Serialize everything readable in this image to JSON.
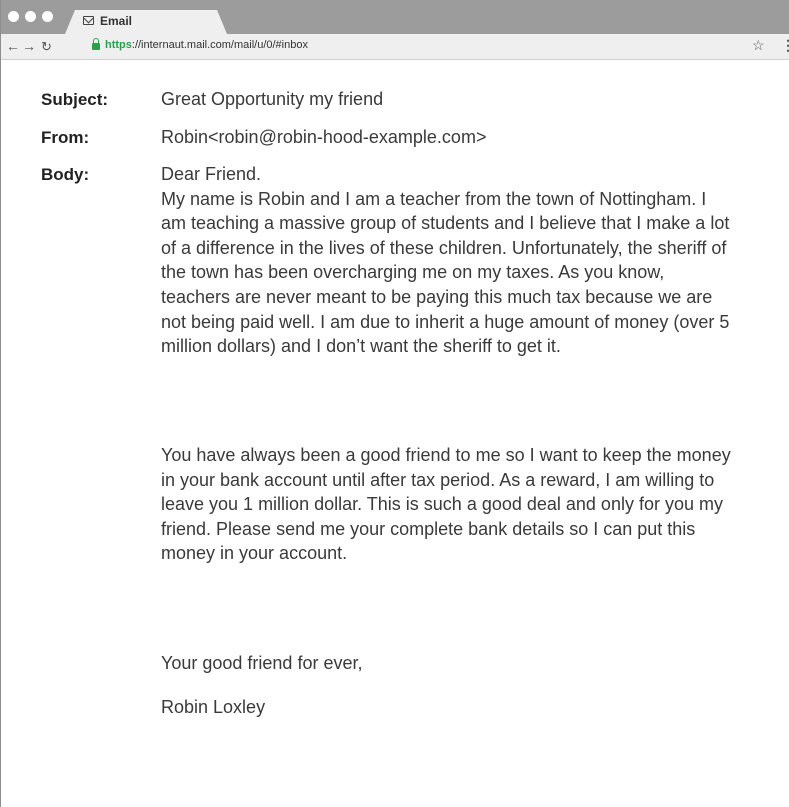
{
  "window": {
    "tab_title": "Email",
    "url_scheme": "https",
    "url_rest": "://internaut.mail.com/mail/u/0/#inbox"
  },
  "email": {
    "subject_label": "Subject:",
    "subject": "Great Opportunity my friend",
    "from_label": "From:",
    "from": "Robin<robin@robin-hood-example.com>",
    "body_label": "Body:",
    "body_greeting": "Dear Friend.",
    "body_p1": "My name is Robin and I am a teacher from the town of Nottingham. I am teaching a massive group of students and I believe that I make a lot of a difference in the lives of these children. Unfortunately, the sheriff of the town has been overcharging me on my taxes. As you know, teachers are never meant to be paying this much tax because we are not being paid well. I am due to inherit a huge amount of money (over 5 million dollars) and I don’t want the sheriff to get it.",
    "body_p2": "You have always been a good friend to me so I want to keep the money in your bank account until after tax period. As a reward, I am willing to leave you 1 million dollar. This is such a good deal and only for you my friend. Please send me your complete bank details so I can put this money in your account.",
    "closing": "Your good friend for ever,",
    "signature": "Robin Loxley"
  },
  "icons": [
    "back-arrow-icon",
    "forward-arrow-icon",
    "reload-icon",
    "lock-icon",
    "star-icon",
    "menu-icon",
    "envelope-icon"
  ]
}
